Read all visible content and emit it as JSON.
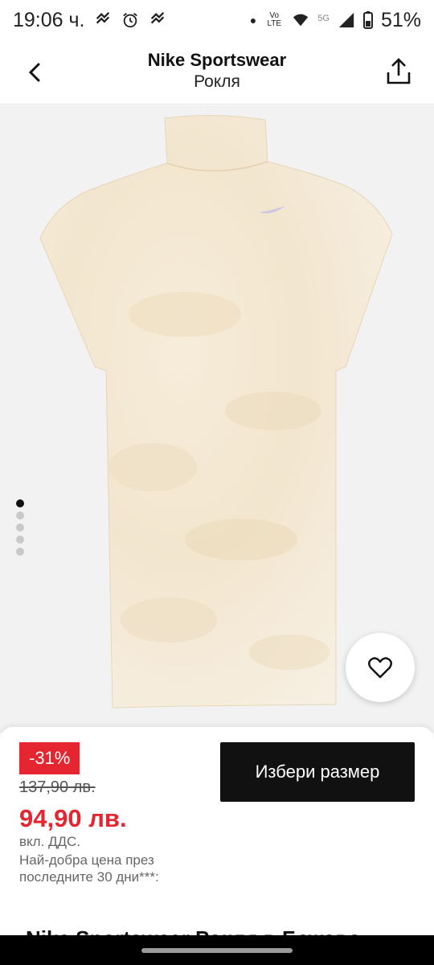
{
  "status_bar": {
    "time": "19:06 ч.",
    "battery": "51%",
    "network": "5G",
    "volte": "Vo LTE",
    "icons": [
      "hearts-icon",
      "alarm-icon",
      "hearts-icon",
      "dot-icon",
      "wifi-icon",
      "signal-icon",
      "battery-icon"
    ]
  },
  "header": {
    "brand": "Nike Sportswear",
    "category": "Рокля",
    "back_icon": "chevron-left-icon",
    "share_icon": "share-icon"
  },
  "gallery": {
    "image": "product-dress-image",
    "image_count": 5,
    "active_index": 0,
    "favorite_icon": "heart-icon"
  },
  "purchase": {
    "discount": "-31%",
    "old_price": "137,90 лв.",
    "new_price": "94,90 лв.",
    "vat_note": "вкл. ДДС.",
    "best_price_note": "Най-добра цена през последните 30 дни***:",
    "size_button": "Избери размер",
    "product_title": "Nike Sportswear Рокля в Бежово"
  },
  "colors": {
    "accent_red": "#e52530",
    "button_black": "#111111",
    "gallery_bg": "#f2f2f2"
  }
}
